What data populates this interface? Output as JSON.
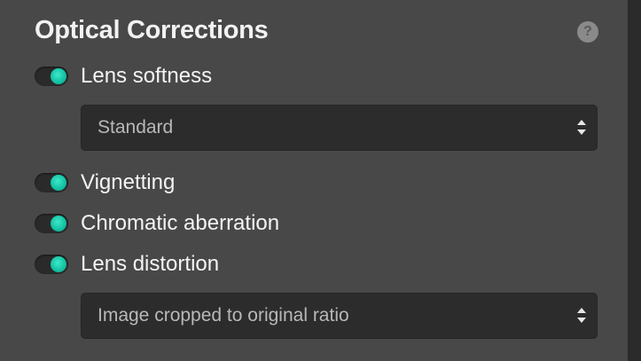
{
  "panel": {
    "title": "Optical Corrections",
    "help_icon": "?"
  },
  "options": [
    {
      "label": "Lens softness",
      "enabled": true
    },
    {
      "label": "Vignetting",
      "enabled": true
    },
    {
      "label": "Chromatic aberration",
      "enabled": true
    },
    {
      "label": "Lens distortion",
      "enabled": true
    }
  ],
  "lens_softness_select": {
    "value": "Standard"
  },
  "lens_distortion_select": {
    "value": "Image cropped to original ratio"
  },
  "colors": {
    "toggle_on": "#14c4a6",
    "panel_bg": "#484848",
    "select_bg": "#2c2c2c"
  }
}
